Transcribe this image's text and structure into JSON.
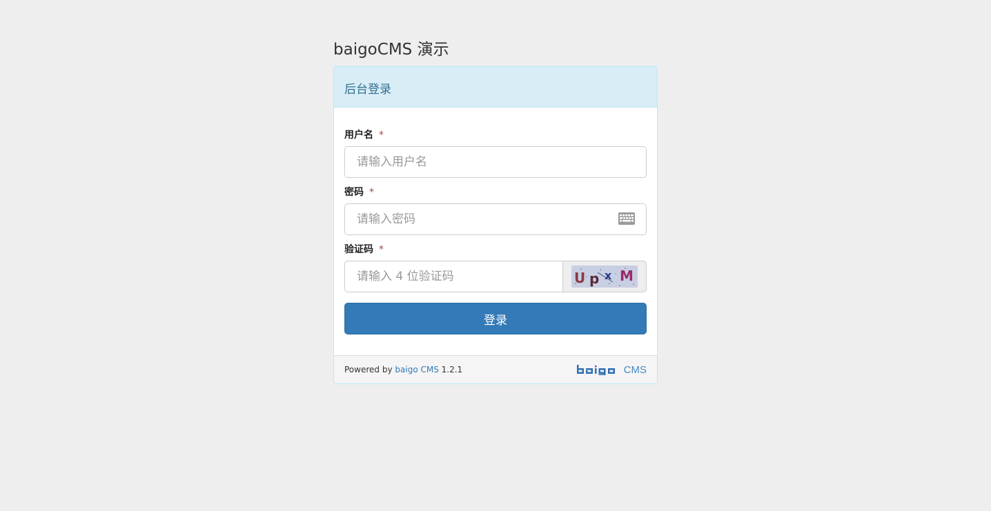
{
  "header": {
    "site_title": "baigoCMS 演示"
  },
  "panel": {
    "heading": "后台登录"
  },
  "form": {
    "username": {
      "label": "用户名",
      "required_mark": "*",
      "placeholder": "请输入用户名"
    },
    "password": {
      "label": "密码",
      "required_mark": "*",
      "placeholder": "请输入密码",
      "icon": "keyboard-icon"
    },
    "captcha": {
      "label": "验证码",
      "required_mark": "*",
      "placeholder": "请输入 4 位验证码",
      "image_text": "UpxM"
    },
    "submit_label": "登录"
  },
  "footer": {
    "powered_by": "Powered by",
    "link_text": "baigo CMS",
    "version": "1.2.1",
    "logo_text": "baigo",
    "logo_suffix": "CMS"
  },
  "colors": {
    "primary": "#337ab7",
    "heading_bg": "#d9edf7",
    "heading_text": "#31708f",
    "page_bg": "#eeeeee",
    "required": "#a94442"
  }
}
